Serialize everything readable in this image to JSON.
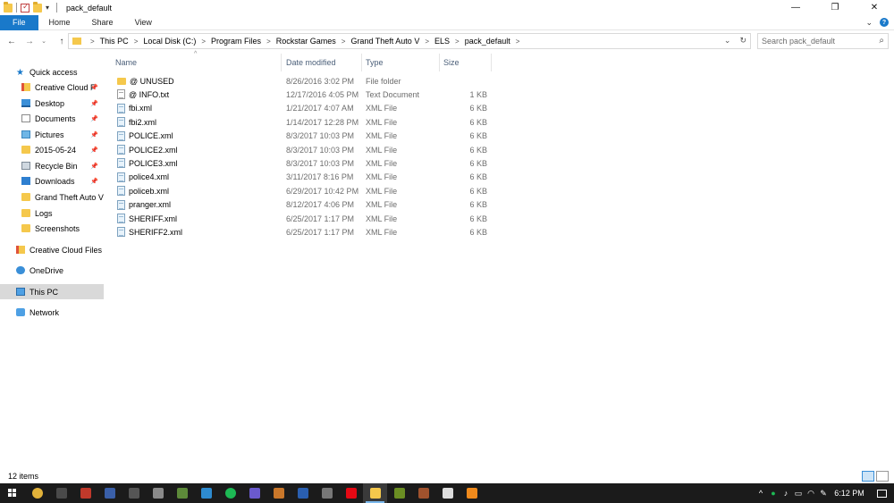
{
  "window": {
    "title": "pack_default",
    "controls": {
      "minimize": "—",
      "maximize": "❐",
      "close": "✕"
    }
  },
  "ribbon": {
    "tabs": [
      "File",
      "Home",
      "Share",
      "View"
    ],
    "expand_icon": "chevron-down-icon",
    "help_icon": "?"
  },
  "address": {
    "crumbs": [
      "This PC",
      "Local Disk (C:)",
      "Program Files",
      "Rockstar Games",
      "Grand Theft Auto V",
      "ELS",
      "pack_default"
    ],
    "search_placeholder": "Search pack_default"
  },
  "nav": {
    "items": [
      {
        "label": "Quick access",
        "icon": "star-icon",
        "pinned": false,
        "selected": false,
        "indent": 0
      },
      {
        "label": "Creative Cloud F",
        "icon": "creative-cloud-folder-icon",
        "pinned": true,
        "selected": false,
        "indent": 1
      },
      {
        "label": "Desktop",
        "icon": "desktop-icon",
        "pinned": true,
        "selected": false,
        "indent": 1
      },
      {
        "label": "Documents",
        "icon": "documents-icon",
        "pinned": true,
        "selected": false,
        "indent": 1
      },
      {
        "label": "Pictures",
        "icon": "pictures-icon",
        "pinned": true,
        "selected": false,
        "indent": 1
      },
      {
        "label": "2015-05-24",
        "icon": "folder-icon",
        "pinned": true,
        "selected": false,
        "indent": 1
      },
      {
        "label": "Recycle Bin",
        "icon": "recycle-bin-icon",
        "pinned": true,
        "selected": false,
        "indent": 1
      },
      {
        "label": "Downloads",
        "icon": "downloads-icon",
        "pinned": true,
        "selected": false,
        "indent": 1
      },
      {
        "label": "Grand Theft Auto V",
        "icon": "folder-icon",
        "pinned": false,
        "selected": false,
        "indent": 1
      },
      {
        "label": "Logs",
        "icon": "folder-icon",
        "pinned": false,
        "selected": false,
        "indent": 1
      },
      {
        "label": "Screenshots",
        "icon": "folder-icon",
        "pinned": false,
        "selected": false,
        "indent": 1
      },
      {
        "label": "Creative Cloud Files",
        "icon": "creative-cloud-folder-icon",
        "pinned": false,
        "selected": false,
        "indent": 0
      },
      {
        "label": "OneDrive",
        "icon": "onedrive-cloud-icon",
        "pinned": false,
        "selected": false,
        "indent": 0
      },
      {
        "label": "This PC",
        "icon": "computer-icon",
        "pinned": false,
        "selected": true,
        "indent": 0
      },
      {
        "label": "Network",
        "icon": "network-icon",
        "pinned": false,
        "selected": false,
        "indent": 0
      }
    ]
  },
  "files": {
    "columns": {
      "name": "Name",
      "date": "Date modified",
      "type": "Type",
      "size": "Size"
    },
    "rows": [
      {
        "name": "@ UNUSED",
        "date": "8/26/2016 3:02 PM",
        "type": "File folder",
        "size": "",
        "icon": "folder-icon"
      },
      {
        "name": "@ INFO.txt",
        "date": "12/17/2016 4:05 PM",
        "type": "Text Document",
        "size": "1 KB",
        "icon": "text-file-icon"
      },
      {
        "name": "fbi.xml",
        "date": "1/21/2017 4:07 AM",
        "type": "XML File",
        "size": "6 KB",
        "icon": "xml-file-icon"
      },
      {
        "name": "fbi2.xml",
        "date": "1/14/2017 12:28 PM",
        "type": "XML File",
        "size": "6 KB",
        "icon": "xml-file-icon"
      },
      {
        "name": "POLICE.xml",
        "date": "8/3/2017 10:03 PM",
        "type": "XML File",
        "size": "6 KB",
        "icon": "xml-file-icon"
      },
      {
        "name": "POLICE2.xml",
        "date": "8/3/2017 10:03 PM",
        "type": "XML File",
        "size": "6 KB",
        "icon": "xml-file-icon"
      },
      {
        "name": "POLICE3.xml",
        "date": "8/3/2017 10:03 PM",
        "type": "XML File",
        "size": "6 KB",
        "icon": "xml-file-icon"
      },
      {
        "name": "police4.xml",
        "date": "3/11/2017 8:16 PM",
        "type": "XML File",
        "size": "6 KB",
        "icon": "xml-file-icon"
      },
      {
        "name": "policeb.xml",
        "date": "6/29/2017 10:42 PM",
        "type": "XML File",
        "size": "6 KB",
        "icon": "xml-file-icon"
      },
      {
        "name": "pranger.xml",
        "date": "8/12/2017 4:06 PM",
        "type": "XML File",
        "size": "6 KB",
        "icon": "xml-file-icon"
      },
      {
        "name": "SHERIFF.xml",
        "date": "6/25/2017 1:17 PM",
        "type": "XML File",
        "size": "6 KB",
        "icon": "xml-file-icon"
      },
      {
        "name": "SHERIFF2.xml",
        "date": "6/25/2017 1:17 PM",
        "type": "XML File",
        "size": "6 KB",
        "icon": "xml-file-icon"
      }
    ]
  },
  "status": {
    "item_count": "12 items"
  },
  "taskbar": {
    "apps": [
      {
        "name": "chrome-icon",
        "color": "#e2b23a"
      },
      {
        "name": "app-icon-2",
        "color": "#4a4a4a"
      },
      {
        "name": "app-icon-3",
        "color": "#c0392b"
      },
      {
        "name": "app-icon-4",
        "color": "#3a5fa8"
      },
      {
        "name": "app-icon-5",
        "color": "#555555"
      },
      {
        "name": "app-icon-6",
        "color": "#8a8a8a"
      },
      {
        "name": "minecraft-icon",
        "color": "#5d8a3a"
      },
      {
        "name": "app-icon-8",
        "color": "#2e8bd0"
      },
      {
        "name": "spotify-icon",
        "color": "#1db954"
      },
      {
        "name": "app-icon-10",
        "color": "#6a5acd"
      },
      {
        "name": "app-icon-11",
        "color": "#c9772a"
      },
      {
        "name": "app-icon-12",
        "color": "#2a5fb0"
      },
      {
        "name": "app-icon-13",
        "color": "#777777"
      },
      {
        "name": "netflix-icon",
        "color": "#e50914"
      },
      {
        "name": "file-explorer-icon",
        "color": "#f5c84c"
      },
      {
        "name": "app-icon-16",
        "color": "#6b8e23"
      },
      {
        "name": "app-icon-17",
        "color": "#a0522d"
      },
      {
        "name": "app-icon-18",
        "color": "#dddddd"
      },
      {
        "name": "app-icon-19",
        "color": "#f08a1c"
      }
    ],
    "active_app_index": 14,
    "clock": "6:12 PM"
  },
  "colors": {
    "accent": "#1979ca",
    "selection": "#d9d9d9",
    "taskbar": "#1b1b1b"
  }
}
